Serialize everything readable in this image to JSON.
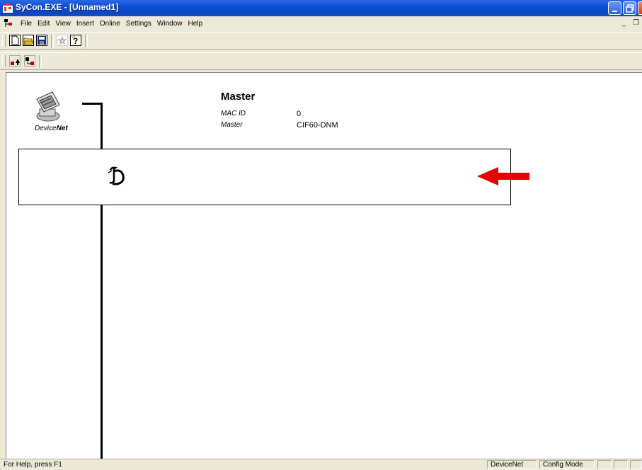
{
  "window": {
    "title": "SyCon.EXE - [Unnamed1]"
  },
  "menu": {
    "items": [
      "File",
      "Edit",
      "View",
      "Insert",
      "Online",
      "Settings",
      "Window",
      "Help"
    ],
    "mdi_min": "_",
    "mdi_restore": "❐"
  },
  "toolbar1": {
    "buttons": [
      "new-icon",
      "open-icon",
      "save-icon",
      "run-icon",
      "help-icon"
    ]
  },
  "toolbar2": {
    "buttons": [
      "move-up-icon",
      "move-down-icon"
    ]
  },
  "network": {
    "bus_name": "DeviceNet",
    "bus_label_normal": "Device",
    "bus_label_bold": "Net",
    "master": {
      "title": "Master",
      "fields": [
        {
          "label": "MAC ID",
          "value": "0"
        },
        {
          "label": "Master",
          "value": "CIF60-DNM"
        }
      ]
    },
    "node_marker": "ᴅ"
  },
  "colors": {
    "arrow": "#e60000",
    "titlebar": "#0a4fd8",
    "chrome": "#ece9d8"
  },
  "statusbar": {
    "help": "For Help, press F1",
    "panes": [
      "DeviceNet",
      "Config Mode",
      "",
      "",
      ""
    ]
  }
}
